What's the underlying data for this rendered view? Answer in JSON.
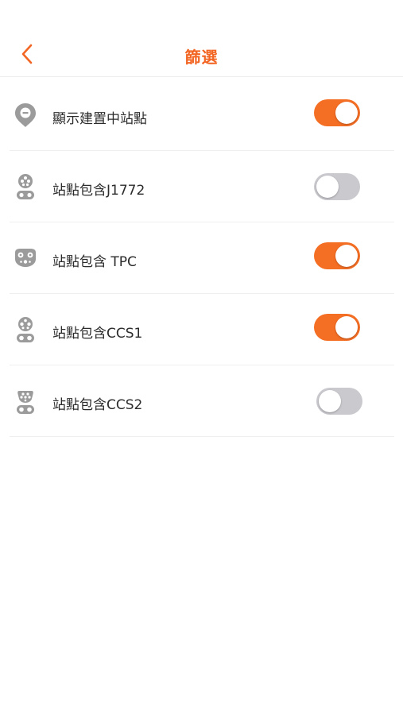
{
  "header": {
    "title": "篩選",
    "back_icon": "chevron-left-icon",
    "accent_color": "#f26522"
  },
  "filters": [
    {
      "icon": "map-pin-icon",
      "label": "顯示建置中站點",
      "enabled": true
    },
    {
      "icon": "connector-plug-icon",
      "label": "站點包含J1772",
      "enabled": false
    },
    {
      "icon": "connector-plug-icon",
      "label": "站點包含 TPC",
      "enabled": true
    },
    {
      "icon": "connector-plug-icon",
      "label": "站點包含CCS1",
      "enabled": true
    },
    {
      "icon": "connector-plug-icon",
      "label": "站點包含CCS2",
      "enabled": false
    }
  ],
  "colors": {
    "toggle_on": "#f46e24",
    "toggle_off": "#c9c9ce",
    "icon_gray": "#9b9b9b"
  }
}
